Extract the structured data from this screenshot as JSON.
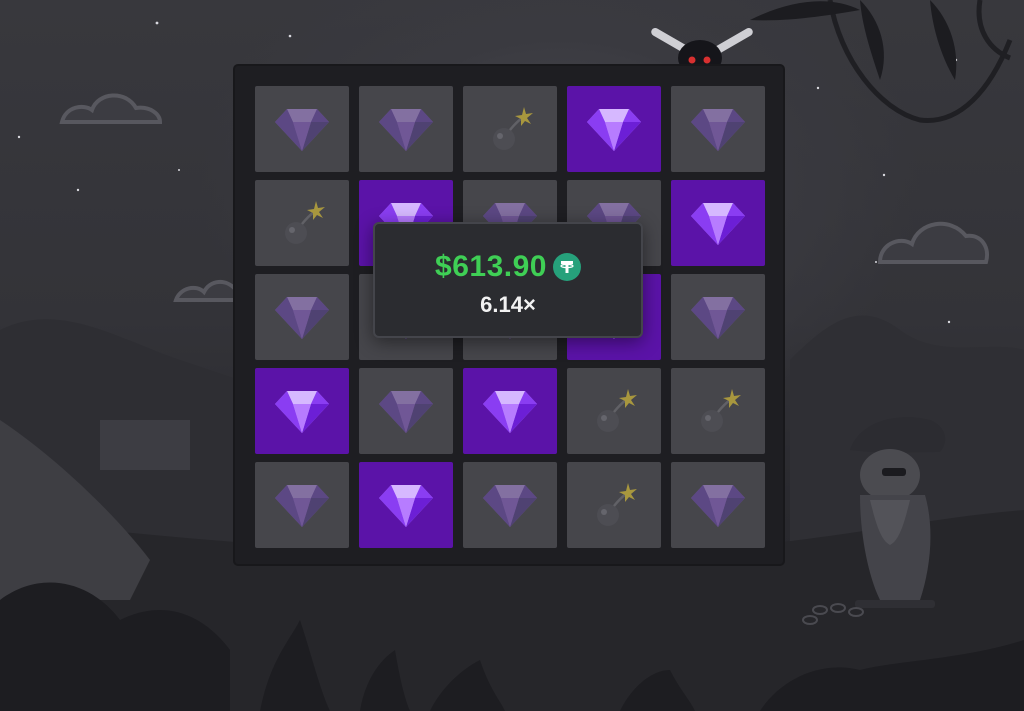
{
  "popup": {
    "amount": "$613.90",
    "currency_icon": "tether-icon",
    "multiplier": "6.14×",
    "amount_color": "#3fcf55"
  },
  "board": {
    "rows": 5,
    "columns": 5,
    "pick_color": "#5b13a8",
    "tile_color": "#46464b",
    "tiles": [
      [
        "gem-dim",
        "gem-dim",
        "bomb",
        "gem-picked",
        "gem-dim"
      ],
      [
        "bomb",
        "gem-picked",
        "gem-dim",
        "gem-dim",
        "gem-picked"
      ],
      [
        "gem-dim",
        "gem-dim",
        "gem-dim",
        "gem-picked",
        "gem-dim"
      ],
      [
        "gem-picked",
        "gem-dim",
        "gem-picked",
        "bomb",
        "bomb"
      ],
      [
        "gem-dim",
        "gem-picked",
        "gem-dim",
        "bomb",
        "gem-dim"
      ]
    ]
  }
}
